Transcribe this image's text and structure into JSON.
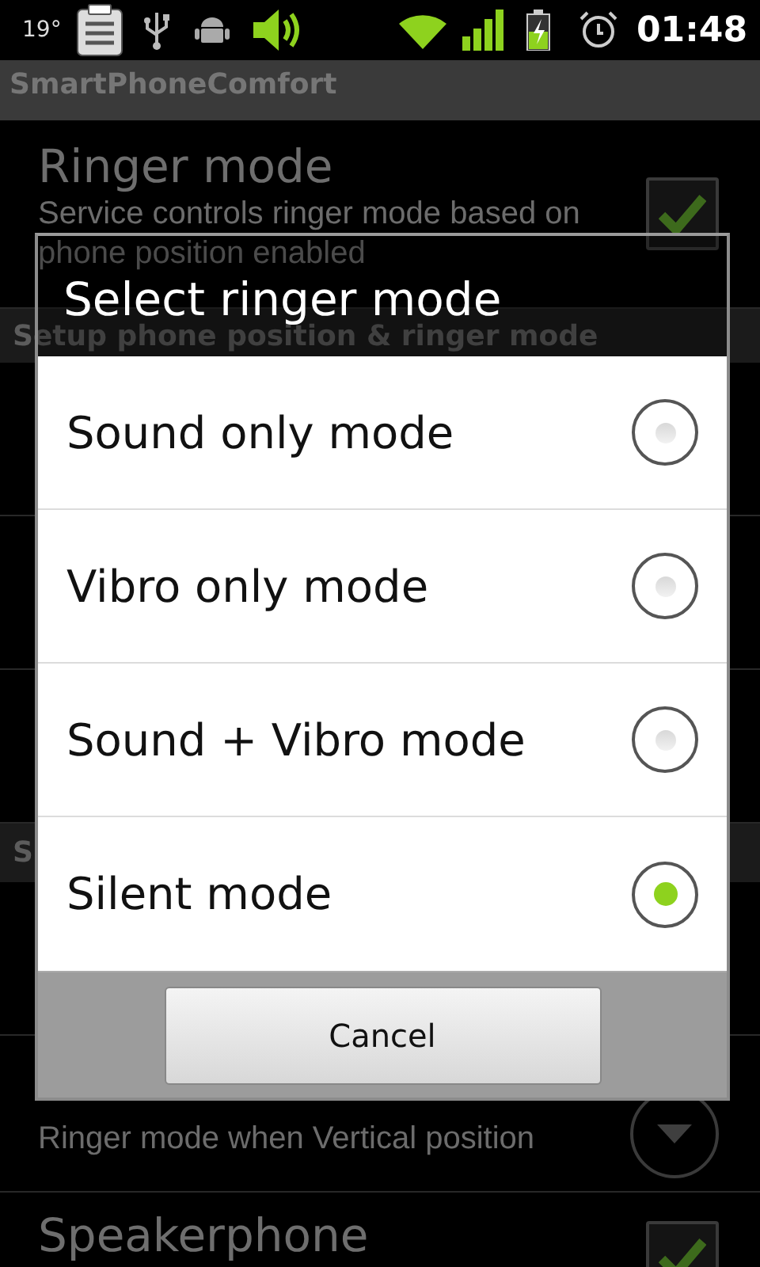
{
  "status_bar": {
    "temperature": "19°",
    "time": "01:48"
  },
  "app_title": "SmartPhoneComfort",
  "preferences": [
    {
      "kind": "checkbox",
      "title": "Ringer mode",
      "summary": "Service controls ringer mode based on phone position enabled",
      "checked": true
    },
    {
      "kind": "header",
      "title": "Setup phone position & ringer mode"
    },
    {
      "kind": "covered"
    },
    {
      "kind": "covered"
    },
    {
      "kind": "covered"
    },
    {
      "kind": "header",
      "title": "S"
    },
    {
      "kind": "covered"
    },
    {
      "kind": "list",
      "summary": "Ringer mode when Vertical position"
    },
    {
      "kind": "checkbox",
      "title": "Speakerphone",
      "checked": true
    }
  ],
  "dialog": {
    "title": "Select ringer mode",
    "options": [
      {
        "label": "Sound only mode",
        "selected": false
      },
      {
        "label": "Vibro only mode",
        "selected": false
      },
      {
        "label": "Sound + Vibro mode",
        "selected": false
      },
      {
        "label": "Silent mode",
        "selected": true
      }
    ],
    "buttons": [
      "Cancel"
    ]
  }
}
